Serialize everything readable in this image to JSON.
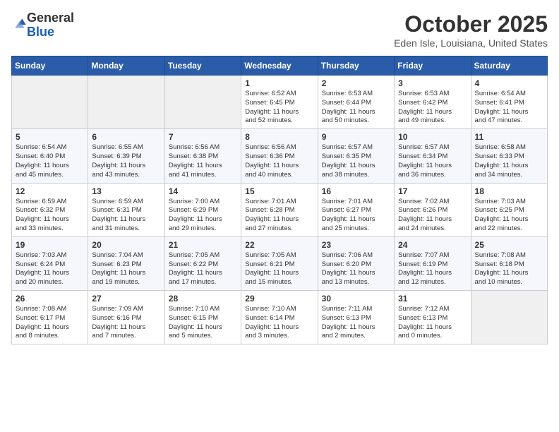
{
  "header": {
    "logo_line1": "General",
    "logo_line2": "Blue",
    "month": "October 2025",
    "location": "Eden Isle, Louisiana, United States"
  },
  "days_of_week": [
    "Sunday",
    "Monday",
    "Tuesday",
    "Wednesday",
    "Thursday",
    "Friday",
    "Saturday"
  ],
  "weeks": [
    [
      {
        "day": "",
        "info": ""
      },
      {
        "day": "",
        "info": ""
      },
      {
        "day": "",
        "info": ""
      },
      {
        "day": "1",
        "info": "Sunrise: 6:52 AM\nSunset: 6:45 PM\nDaylight: 11 hours\nand 52 minutes."
      },
      {
        "day": "2",
        "info": "Sunrise: 6:53 AM\nSunset: 6:44 PM\nDaylight: 11 hours\nand 50 minutes."
      },
      {
        "day": "3",
        "info": "Sunrise: 6:53 AM\nSunset: 6:42 PM\nDaylight: 11 hours\nand 49 minutes."
      },
      {
        "day": "4",
        "info": "Sunrise: 6:54 AM\nSunset: 6:41 PM\nDaylight: 11 hours\nand 47 minutes."
      }
    ],
    [
      {
        "day": "5",
        "info": "Sunrise: 6:54 AM\nSunset: 6:40 PM\nDaylight: 11 hours\nand 45 minutes."
      },
      {
        "day": "6",
        "info": "Sunrise: 6:55 AM\nSunset: 6:39 PM\nDaylight: 11 hours\nand 43 minutes."
      },
      {
        "day": "7",
        "info": "Sunrise: 6:56 AM\nSunset: 6:38 PM\nDaylight: 11 hours\nand 41 minutes."
      },
      {
        "day": "8",
        "info": "Sunrise: 6:56 AM\nSunset: 6:36 PM\nDaylight: 11 hours\nand 40 minutes."
      },
      {
        "day": "9",
        "info": "Sunrise: 6:57 AM\nSunset: 6:35 PM\nDaylight: 11 hours\nand 38 minutes."
      },
      {
        "day": "10",
        "info": "Sunrise: 6:57 AM\nSunset: 6:34 PM\nDaylight: 11 hours\nand 36 minutes."
      },
      {
        "day": "11",
        "info": "Sunrise: 6:58 AM\nSunset: 6:33 PM\nDaylight: 11 hours\nand 34 minutes."
      }
    ],
    [
      {
        "day": "12",
        "info": "Sunrise: 6:59 AM\nSunset: 6:32 PM\nDaylight: 11 hours\nand 33 minutes."
      },
      {
        "day": "13",
        "info": "Sunrise: 6:59 AM\nSunset: 6:31 PM\nDaylight: 11 hours\nand 31 minutes."
      },
      {
        "day": "14",
        "info": "Sunrise: 7:00 AM\nSunset: 6:29 PM\nDaylight: 11 hours\nand 29 minutes."
      },
      {
        "day": "15",
        "info": "Sunrise: 7:01 AM\nSunset: 6:28 PM\nDaylight: 11 hours\nand 27 minutes."
      },
      {
        "day": "16",
        "info": "Sunrise: 7:01 AM\nSunset: 6:27 PM\nDaylight: 11 hours\nand 25 minutes."
      },
      {
        "day": "17",
        "info": "Sunrise: 7:02 AM\nSunset: 6:26 PM\nDaylight: 11 hours\nand 24 minutes."
      },
      {
        "day": "18",
        "info": "Sunrise: 7:03 AM\nSunset: 6:25 PM\nDaylight: 11 hours\nand 22 minutes."
      }
    ],
    [
      {
        "day": "19",
        "info": "Sunrise: 7:03 AM\nSunset: 6:24 PM\nDaylight: 11 hours\nand 20 minutes."
      },
      {
        "day": "20",
        "info": "Sunrise: 7:04 AM\nSunset: 6:23 PM\nDaylight: 11 hours\nand 19 minutes."
      },
      {
        "day": "21",
        "info": "Sunrise: 7:05 AM\nSunset: 6:22 PM\nDaylight: 11 hours\nand 17 minutes."
      },
      {
        "day": "22",
        "info": "Sunrise: 7:05 AM\nSunset: 6:21 PM\nDaylight: 11 hours\nand 15 minutes."
      },
      {
        "day": "23",
        "info": "Sunrise: 7:06 AM\nSunset: 6:20 PM\nDaylight: 11 hours\nand 13 minutes."
      },
      {
        "day": "24",
        "info": "Sunrise: 7:07 AM\nSunset: 6:19 PM\nDaylight: 11 hours\nand 12 minutes."
      },
      {
        "day": "25",
        "info": "Sunrise: 7:08 AM\nSunset: 6:18 PM\nDaylight: 11 hours\nand 10 minutes."
      }
    ],
    [
      {
        "day": "26",
        "info": "Sunrise: 7:08 AM\nSunset: 6:17 PM\nDaylight: 11 hours\nand 8 minutes."
      },
      {
        "day": "27",
        "info": "Sunrise: 7:09 AM\nSunset: 6:16 PM\nDaylight: 11 hours\nand 7 minutes."
      },
      {
        "day": "28",
        "info": "Sunrise: 7:10 AM\nSunset: 6:15 PM\nDaylight: 11 hours\nand 5 minutes."
      },
      {
        "day": "29",
        "info": "Sunrise: 7:10 AM\nSunset: 6:14 PM\nDaylight: 11 hours\nand 3 minutes."
      },
      {
        "day": "30",
        "info": "Sunrise: 7:11 AM\nSunset: 6:13 PM\nDaylight: 11 hours\nand 2 minutes."
      },
      {
        "day": "31",
        "info": "Sunrise: 7:12 AM\nSunset: 6:13 PM\nDaylight: 11 hours\nand 0 minutes."
      },
      {
        "day": "",
        "info": ""
      }
    ]
  ]
}
